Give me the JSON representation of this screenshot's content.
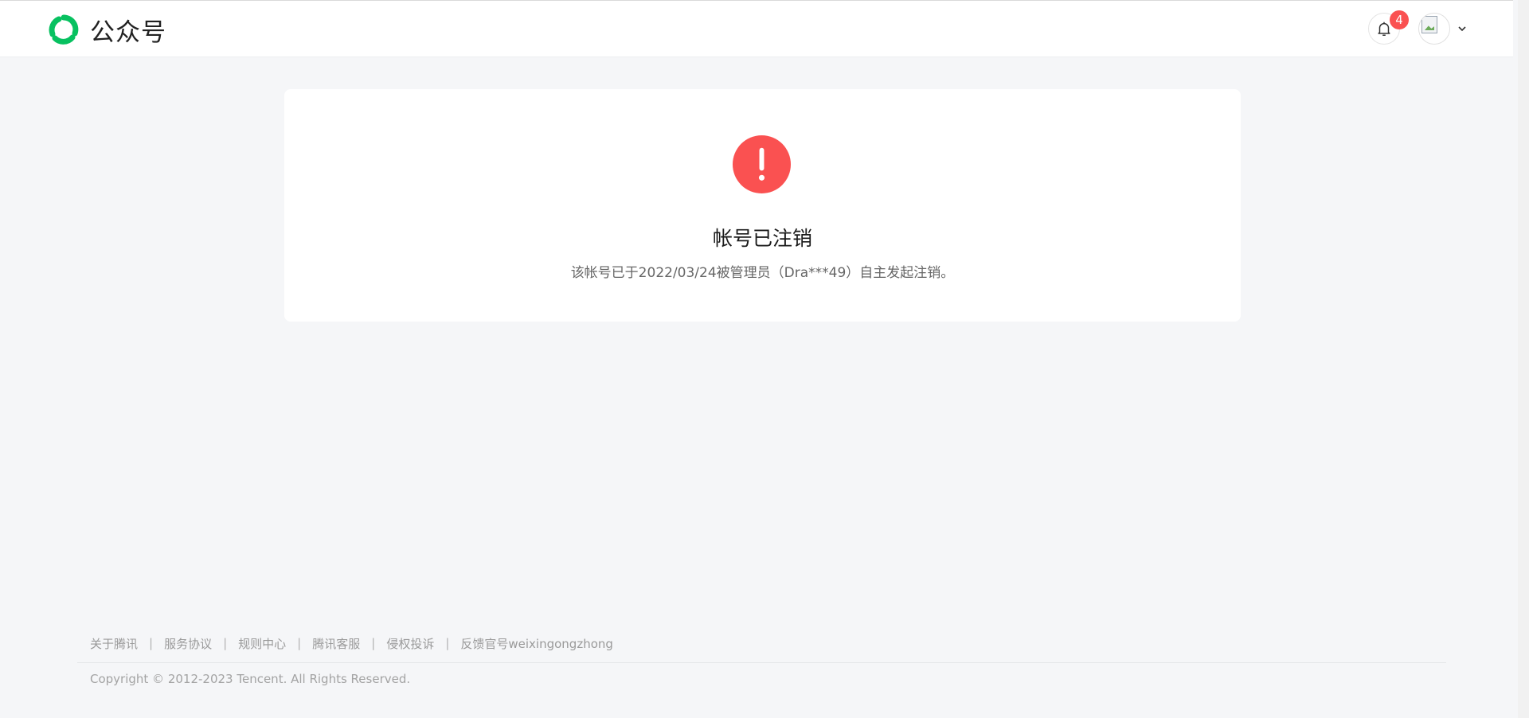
{
  "header": {
    "logo_text": "公众号",
    "logo_icon": "wechat-official-account-logo-icon",
    "notification_icon": "bell-icon",
    "notification_count": "4",
    "avatar_icon": "broken-image-icon",
    "dropdown_icon": "chevron-down-icon"
  },
  "notice": {
    "icon": "exclamation-circle-icon",
    "title": "帐号已注销",
    "description": "该帐号已于2022/03/24被管理员（Dra***49）自主发起注销。"
  },
  "footer": {
    "links": [
      "关于腾讯",
      "服务协议",
      "规则中心",
      "腾讯客服",
      "侵权投诉",
      "反馈官号weixingongzhong"
    ],
    "separator": "|",
    "copyright": "Copyright © 2012-2023 Tencent. All Rights Reserved."
  },
  "colors": {
    "brand_green": "#07c160",
    "warning_red": "#fa5151",
    "page_background": "#f5f6f8"
  }
}
